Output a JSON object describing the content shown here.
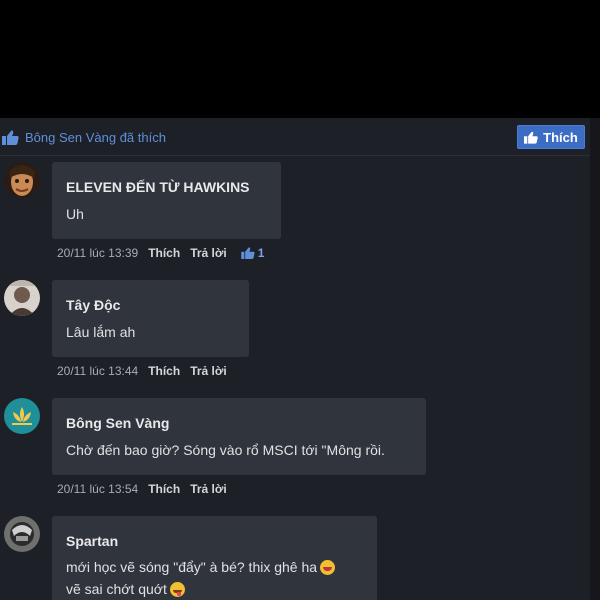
{
  "like_bar": {
    "liked_text": "Bông Sen Vàng đã thích",
    "like_button_label": "Thích"
  },
  "colors": {
    "accent": "#3b6dc4",
    "panel_background": "#1d2027",
    "bubble_background": "#30343c"
  },
  "comments": [
    {
      "author": "ELEVEN ĐẾN TỪ HAWKINS",
      "lines": [
        "Uh"
      ],
      "time": "20/11 lúc 13:39",
      "like_label": "Thích",
      "reply_label": "Trả lời",
      "reaction_count": "1"
    },
    {
      "author": "Tây Độc",
      "lines": [
        "Lâu lắm ah"
      ],
      "time": "20/11 lúc 13:44",
      "like_label": "Thích",
      "reply_label": "Trả lời"
    },
    {
      "author": "Bông Sen Vàng",
      "lines": [
        "Chờ đến bao giờ? Sóng vào rổ MSCI tới \"Mông rồi."
      ],
      "time": "20/11 lúc 13:54",
      "like_label": "Thích",
      "reply_label": "Trả lời"
    },
    {
      "author": "Spartan",
      "lines": [
        "mới học vẽ sóng \"đẩy\" à bé? thix ghê ha",
        "vẽ sai chớt quớt"
      ]
    }
  ]
}
